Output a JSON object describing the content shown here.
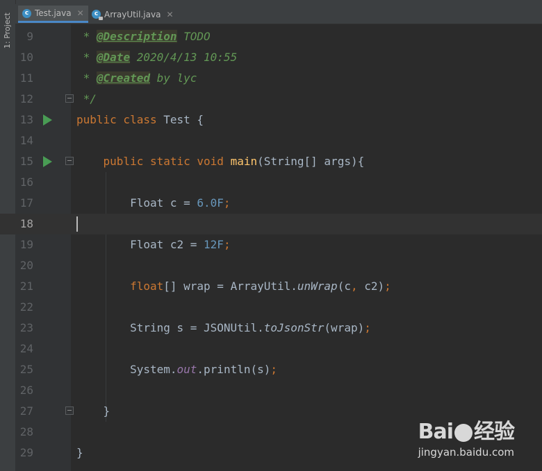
{
  "sidebar": {
    "project_label": "1: Project"
  },
  "tabs": [
    {
      "label": "Test.java",
      "active": true
    },
    {
      "label": "ArrayUtil.java",
      "active": false
    }
  ],
  "editor": {
    "current_line": 18,
    "lines": [
      {
        "num": "9",
        "d1": "@Description",
        "d2": " TODO"
      },
      {
        "num": "10",
        "d1": "@Date",
        "d2": " 2020/4/13 10:55"
      },
      {
        "num": "11",
        "d1": "@Created",
        "d2": " by lyc"
      },
      {
        "num": "12",
        "t": "*/"
      },
      {
        "num": "13",
        "a": "public class",
        "b": " Test {"
      },
      {
        "num": "14"
      },
      {
        "num": "15",
        "a": "public static void",
        "f": "main",
        "b": "(String[] args){"
      },
      {
        "num": "16"
      },
      {
        "num": "17",
        "a": "Float c = ",
        "n": "6.0F",
        "s": ";"
      },
      {
        "num": "18"
      },
      {
        "num": "19",
        "a": "Float c2 = ",
        "n": "12F",
        "s": ";"
      },
      {
        "num": "20"
      },
      {
        "num": "21",
        "k": "float",
        "a": "[] wrap = ArrayUtil.",
        "i": "unWrap",
        "b": "(c",
        "c": ",",
        "e": " c2)",
        "s": ";"
      },
      {
        "num": "22"
      },
      {
        "num": "23",
        "a": "String s = JSONUtil.",
        "i": "toJsonStr",
        "b": "(wrap)",
        "s": ";"
      },
      {
        "num": "24"
      },
      {
        "num": "25",
        "a": "System.",
        "o": "out",
        "b": ".println(s)",
        "s": ";"
      },
      {
        "num": "26"
      },
      {
        "num": "27",
        "t": "}"
      },
      {
        "num": "28"
      },
      {
        "num": "29",
        "t": "}"
      }
    ]
  },
  "watermark": {
    "logo_left": "Bai",
    "logo_right": "经验",
    "url": "jingyan.baidu.com"
  },
  "colors": {
    "background": "#2b2b2b",
    "keyword": "#cc7832",
    "number": "#6897bb",
    "method": "#ffc66d",
    "doc": "#629755"
  }
}
